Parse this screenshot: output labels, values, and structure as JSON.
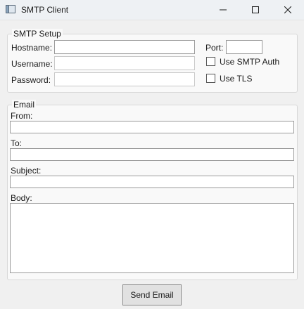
{
  "window": {
    "title": "SMTP Client",
    "icon": "app-window-icon"
  },
  "window_controls": {
    "minimize_icon": "minimize-icon",
    "maximize_icon": "maximize-icon",
    "close_icon": "close-icon"
  },
  "smtp_setup": {
    "title": "SMTP Setup",
    "hostname_label": "Hostname:",
    "hostname_value": "",
    "username_label": "Username:",
    "username_value": "",
    "password_label": "Password:",
    "password_value": "",
    "port_label": "Port:",
    "port_value": "",
    "use_smtp_auth_label": "Use SMTP Auth",
    "use_smtp_auth_checked": false,
    "use_tls_label": "Use TLS",
    "use_tls_checked": false
  },
  "email": {
    "title": "Email",
    "from_label": "From:",
    "from_value": "",
    "to_label": "To:",
    "to_value": "",
    "subject_label": "Subject:",
    "subject_value": "",
    "body_label": "Body:",
    "body_value": ""
  },
  "actions": {
    "send_label": "Send Email"
  }
}
